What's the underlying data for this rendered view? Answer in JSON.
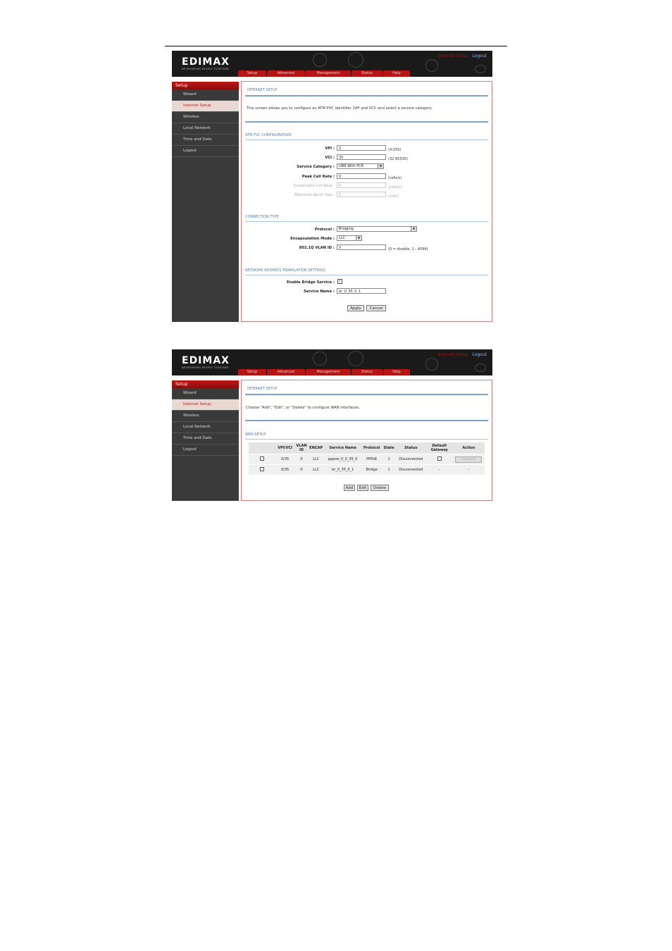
{
  "brand": {
    "logo": "EDIMAX",
    "tagline": "NETWORKING PEOPLE TOGETHER"
  },
  "header": {
    "current": "Internet Setup",
    "logout": "Logout"
  },
  "tabs": [
    "Setup",
    "Advanced",
    "Management",
    "Status",
    "Help"
  ],
  "sidebar": {
    "title": "Setup",
    "items": [
      "Wizard",
      "Internet Setup",
      "Wireless",
      "Local Network",
      "Time and Date",
      "Logout"
    ]
  },
  "screen1": {
    "title": "INTERNET SETUP",
    "desc": "This screen allows you to configure an ATM PVC identifier (VPI and VCI) and select a service category.",
    "atm": {
      "title": "ATM PVC CONFIGURATION",
      "vpi_label": "VPI :",
      "vpi_value": "0",
      "vpi_hint": "(0-255)",
      "vci_label": "VCI :",
      "vci_value": "35",
      "vci_hint": "(32-65535)",
      "service_label": "Service Category :",
      "service_value": "UBR With PCR",
      "pcr_label": "Peak Cell Rate :",
      "pcr_value": "0",
      "pcr_hint": "(cells/s)",
      "scr_label": "Sustainable Cell Rate :",
      "scr_value": "0",
      "scr_hint": "(cells/s)",
      "mbs_label": "Maximum Burst Size :",
      "mbs_value": "0",
      "mbs_hint": "(cells)"
    },
    "conn": {
      "title": "CONNECTION TYPE",
      "protocol_label": "Protocol :",
      "protocol_value": "Bridging",
      "encap_label": "Encapsulation Mode :",
      "encap_value": "LLC",
      "vlan_label": "802.1Q VLAN ID :",
      "vlan_value": "0",
      "vlan_hint": "(0 = disable, 1 - 4094)"
    },
    "nat": {
      "title": "NETWORK ADDRESS TRANSLATION SETTINGS",
      "bridge_label": "Enable Bridge Service :",
      "bridge_checked": "✓",
      "service_name_label": "Service Name :",
      "service_name_value": "br_0_35_0_1"
    },
    "apply": "Apply",
    "cancel": "Cancel"
  },
  "screen2": {
    "title": "INTERNET SETUP",
    "desc": "Choose \"Add\", \"Edit\", or \"Delete\" to configure WAN interfaces.",
    "wan_title": "WAN SETUP",
    "columns": [
      "",
      "VPI/VCI",
      "VLAN ID",
      "ENCAP",
      "Service Name",
      "Protocol",
      "State",
      "Status",
      "Default Gateway",
      "Action"
    ],
    "rows": [
      {
        "vpivci": "0/35",
        "vlan": "0",
        "encap": "LLC",
        "name": "pppoe_0_0_35_0",
        "protocol": "PPPoE",
        "state": "1",
        "status": "Disconnected",
        "gw": "",
        "action": "Connect"
      },
      {
        "vpivci": "0/35",
        "vlan": "0",
        "encap": "LLC",
        "name": "br_0_35_0_1",
        "protocol": "Bridge",
        "state": "1",
        "status": "Disconnected",
        "gw": "-",
        "action": "-"
      }
    ],
    "add": "Add",
    "edit": "Edit",
    "delete": "Delete"
  }
}
